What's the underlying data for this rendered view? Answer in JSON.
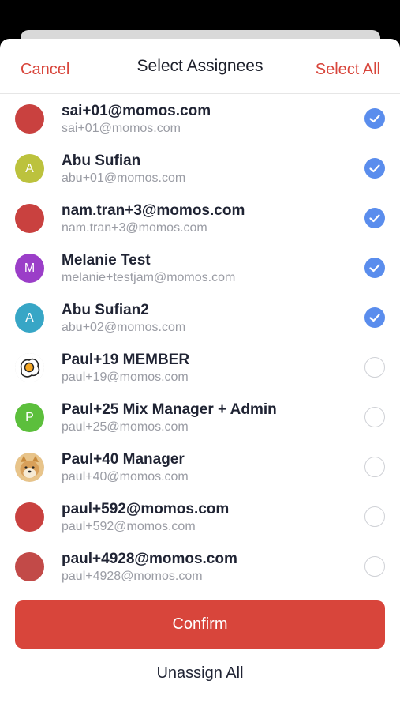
{
  "header": {
    "cancel_label": "Cancel",
    "title": "Select Assignees",
    "select_all_label": "Select All"
  },
  "assignees": [
    {
      "name": "sai+01@momos.com",
      "email": "sai+01@momos.com",
      "avatar": {
        "type": "color",
        "initial": "",
        "color": "#c9413f"
      },
      "selected": true
    },
    {
      "name": "Abu Sufian",
      "email": "abu+01@momos.com",
      "avatar": {
        "type": "initial",
        "initial": "A",
        "color": "#bcc23d"
      },
      "selected": true
    },
    {
      "name": "nam.tran+3@momos.com",
      "email": "nam.tran+3@momos.com",
      "avatar": {
        "type": "color",
        "initial": "",
        "color": "#c9413f"
      },
      "selected": true
    },
    {
      "name": "Melanie Test",
      "email": "melanie+testjam@momos.com",
      "avatar": {
        "type": "initial",
        "initial": "M",
        "color": "#9b3ec8"
      },
      "selected": true
    },
    {
      "name": "Abu Sufian2",
      "email": "abu+02@momos.com",
      "avatar": {
        "type": "initial",
        "initial": "A",
        "color": "#37a6c6"
      },
      "selected": true
    },
    {
      "name": "Paul+19 MEMBER",
      "email": "paul+19@momos.com",
      "avatar": {
        "type": "image",
        "icon": "fried-egg-icon",
        "initial": ""
      },
      "selected": false
    },
    {
      "name": "Paul+25 Mix Manager + Admin",
      "email": "paul+25@momos.com",
      "avatar": {
        "type": "initial",
        "initial": "P",
        "color": "#5cbf3c"
      },
      "selected": false
    },
    {
      "name": "Paul+40 Manager",
      "email": "paul+40@momos.com",
      "avatar": {
        "type": "image",
        "icon": "shiba-dog-icon",
        "initial": ""
      },
      "selected": false
    },
    {
      "name": "paul+592@momos.com",
      "email": "paul+592@momos.com",
      "avatar": {
        "type": "color",
        "initial": "",
        "color": "#c9413f"
      },
      "selected": false
    },
    {
      "name": "paul+4928@momos.com",
      "email": "paul+4928@momos.com",
      "avatar": {
        "type": "color",
        "initial": "",
        "color": "#c24a48"
      },
      "selected": false
    }
  ],
  "footer": {
    "confirm_label": "Confirm",
    "unassign_all_label": "Unassign All"
  },
  "colors": {
    "accent": "#d8453b",
    "check": "#5a8ded"
  }
}
